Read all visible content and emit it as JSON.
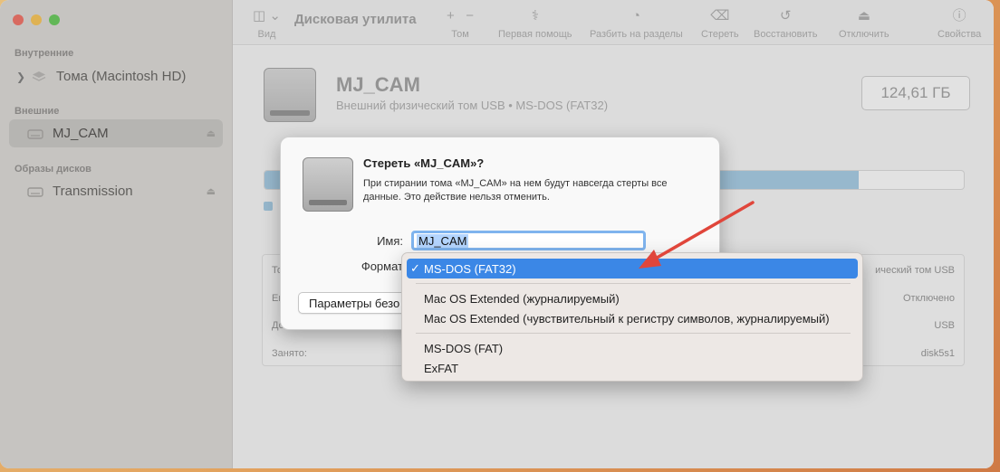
{
  "window": {
    "title": "Дисковая утилита"
  },
  "sidebar": {
    "sections": [
      {
        "label": "Внутренние",
        "items": [
          {
            "label": "Тома (Macintosh HD)",
            "icon": "layers-icon"
          }
        ]
      },
      {
        "label": "Внешние",
        "items": [
          {
            "label": "MJ_CAM",
            "icon": "drive-icon",
            "selected": true
          }
        ]
      },
      {
        "label": "Образы дисков",
        "items": [
          {
            "label": "Transmission",
            "icon": "drive-icon"
          }
        ]
      }
    ]
  },
  "toolbar": {
    "view": "Вид",
    "volume": "Том",
    "first_aid": "Первая помощь",
    "partition": "Разбить на разделы",
    "erase": "Стереть",
    "restore": "Восстановить",
    "unmount": "Отключить",
    "info": "Свойства"
  },
  "device": {
    "name": "MJ_CAM",
    "subtitle": "Внешний физический том USB • MS-DOS (FAT32)",
    "size": "124,61 ГБ",
    "usage_fraction": 0.85
  },
  "info_table": {
    "rows": [
      {
        "key": "То",
        "value": "ический том USB"
      },
      {
        "key": "Ем",
        "value": "Отключено"
      },
      {
        "key": "До",
        "value": "USB"
      },
      {
        "key": "Занято:",
        "value": "disk5s1"
      }
    ]
  },
  "erase_dialog": {
    "title": "Стереть «MJ_CAM»?",
    "message": "При стирании тома «MJ_CAM» на нем будут навсегда стерты все данные. Это действие нельзя отменить.",
    "name_label": "Имя:",
    "name_value": "MJ_CAM",
    "format_label": "Формат",
    "options_button": "Параметры безо"
  },
  "format_menu": {
    "selected": "MS-DOS (FAT32)",
    "group1": [
      "Mac OS Extended (журналируемый)",
      "Mac OS Extended (чувствительный к регистру символов, журналируемый)"
    ],
    "group2": [
      "MS-DOS (FAT)",
      "ExFAT"
    ]
  },
  "colors": {
    "accent": "#3b87e6",
    "annotation_arrow": "#e0463b"
  }
}
